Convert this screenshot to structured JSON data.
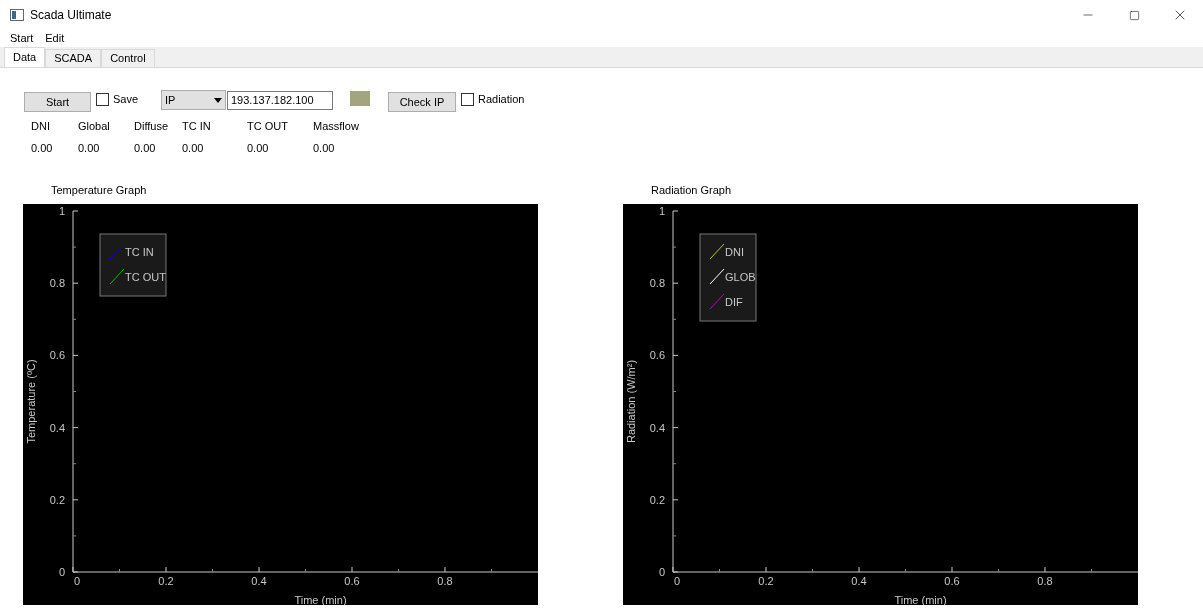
{
  "window": {
    "title": "Scada Ultimate"
  },
  "menu": [
    "Start",
    "Edit"
  ],
  "tabs": [
    {
      "label": "Data",
      "selected": true
    },
    {
      "label": "SCADA",
      "selected": false
    },
    {
      "label": "Control",
      "selected": false
    }
  ],
  "controls": {
    "start_button": "Start",
    "save": {
      "label": "Save",
      "checked": false
    },
    "source": {
      "value": "IP"
    },
    "ip_field": {
      "value": "193.137.182.100"
    },
    "status_indicator": {
      "color": "#a3a57e"
    },
    "check_ip_button": "Check IP",
    "radiation": {
      "label": "Radiation",
      "checked": false
    }
  },
  "readings": [
    {
      "label": "DNI",
      "value": "0.00"
    },
    {
      "label": "Global",
      "value": "0.00"
    },
    {
      "label": "Diffuse",
      "value": "0.00"
    },
    {
      "label": "TC IN",
      "value": "0.00"
    },
    {
      "label": "TC OUT",
      "value": "0.00"
    },
    {
      "label": "Massflow",
      "value": "0.00"
    }
  ],
  "temperature_graph": {
    "title": "Temperature Graph",
    "chart_data": {
      "type": "line",
      "xlabel": "Time (min)",
      "ylabel": "Temperature (ºC)",
      "ylim": [
        0,
        1
      ],
      "yticks": [
        0,
        0.2,
        0.4,
        0.6,
        0.8,
        1
      ],
      "categories": [
        "0",
        "0.2",
        "0.4",
        "0.6",
        "0.8"
      ],
      "series": [
        {
          "name": "TC IN",
          "color": "#0000ff",
          "values": [
            null,
            null,
            null,
            null,
            null
          ]
        },
        {
          "name": "TC OUT",
          "color": "#00c000",
          "values": [
            null,
            null,
            null,
            null,
            null
          ]
        }
      ]
    }
  },
  "radiation_graph": {
    "title": "Radiation Graph",
    "chart_data": {
      "type": "line",
      "xlabel": "Time (min)",
      "ylabel": "Radiation (W/m²)",
      "ylim": [
        0,
        1
      ],
      "yticks": [
        0,
        0.2,
        0.4,
        0.6,
        0.8,
        1
      ],
      "categories": [
        "0",
        "0.2",
        "0.4",
        "0.6",
        "0.8"
      ],
      "series": [
        {
          "name": "DNI",
          "color": "#c8c800",
          "values": [
            null,
            null,
            null,
            null,
            null
          ]
        },
        {
          "name": "GLOB",
          "color": "#ffffff",
          "values": [
            null,
            null,
            null,
            null,
            null
          ]
        },
        {
          "name": "DIF",
          "color": "#c000c0",
          "values": [
            null,
            null,
            null,
            null,
            null
          ]
        }
      ]
    }
  }
}
